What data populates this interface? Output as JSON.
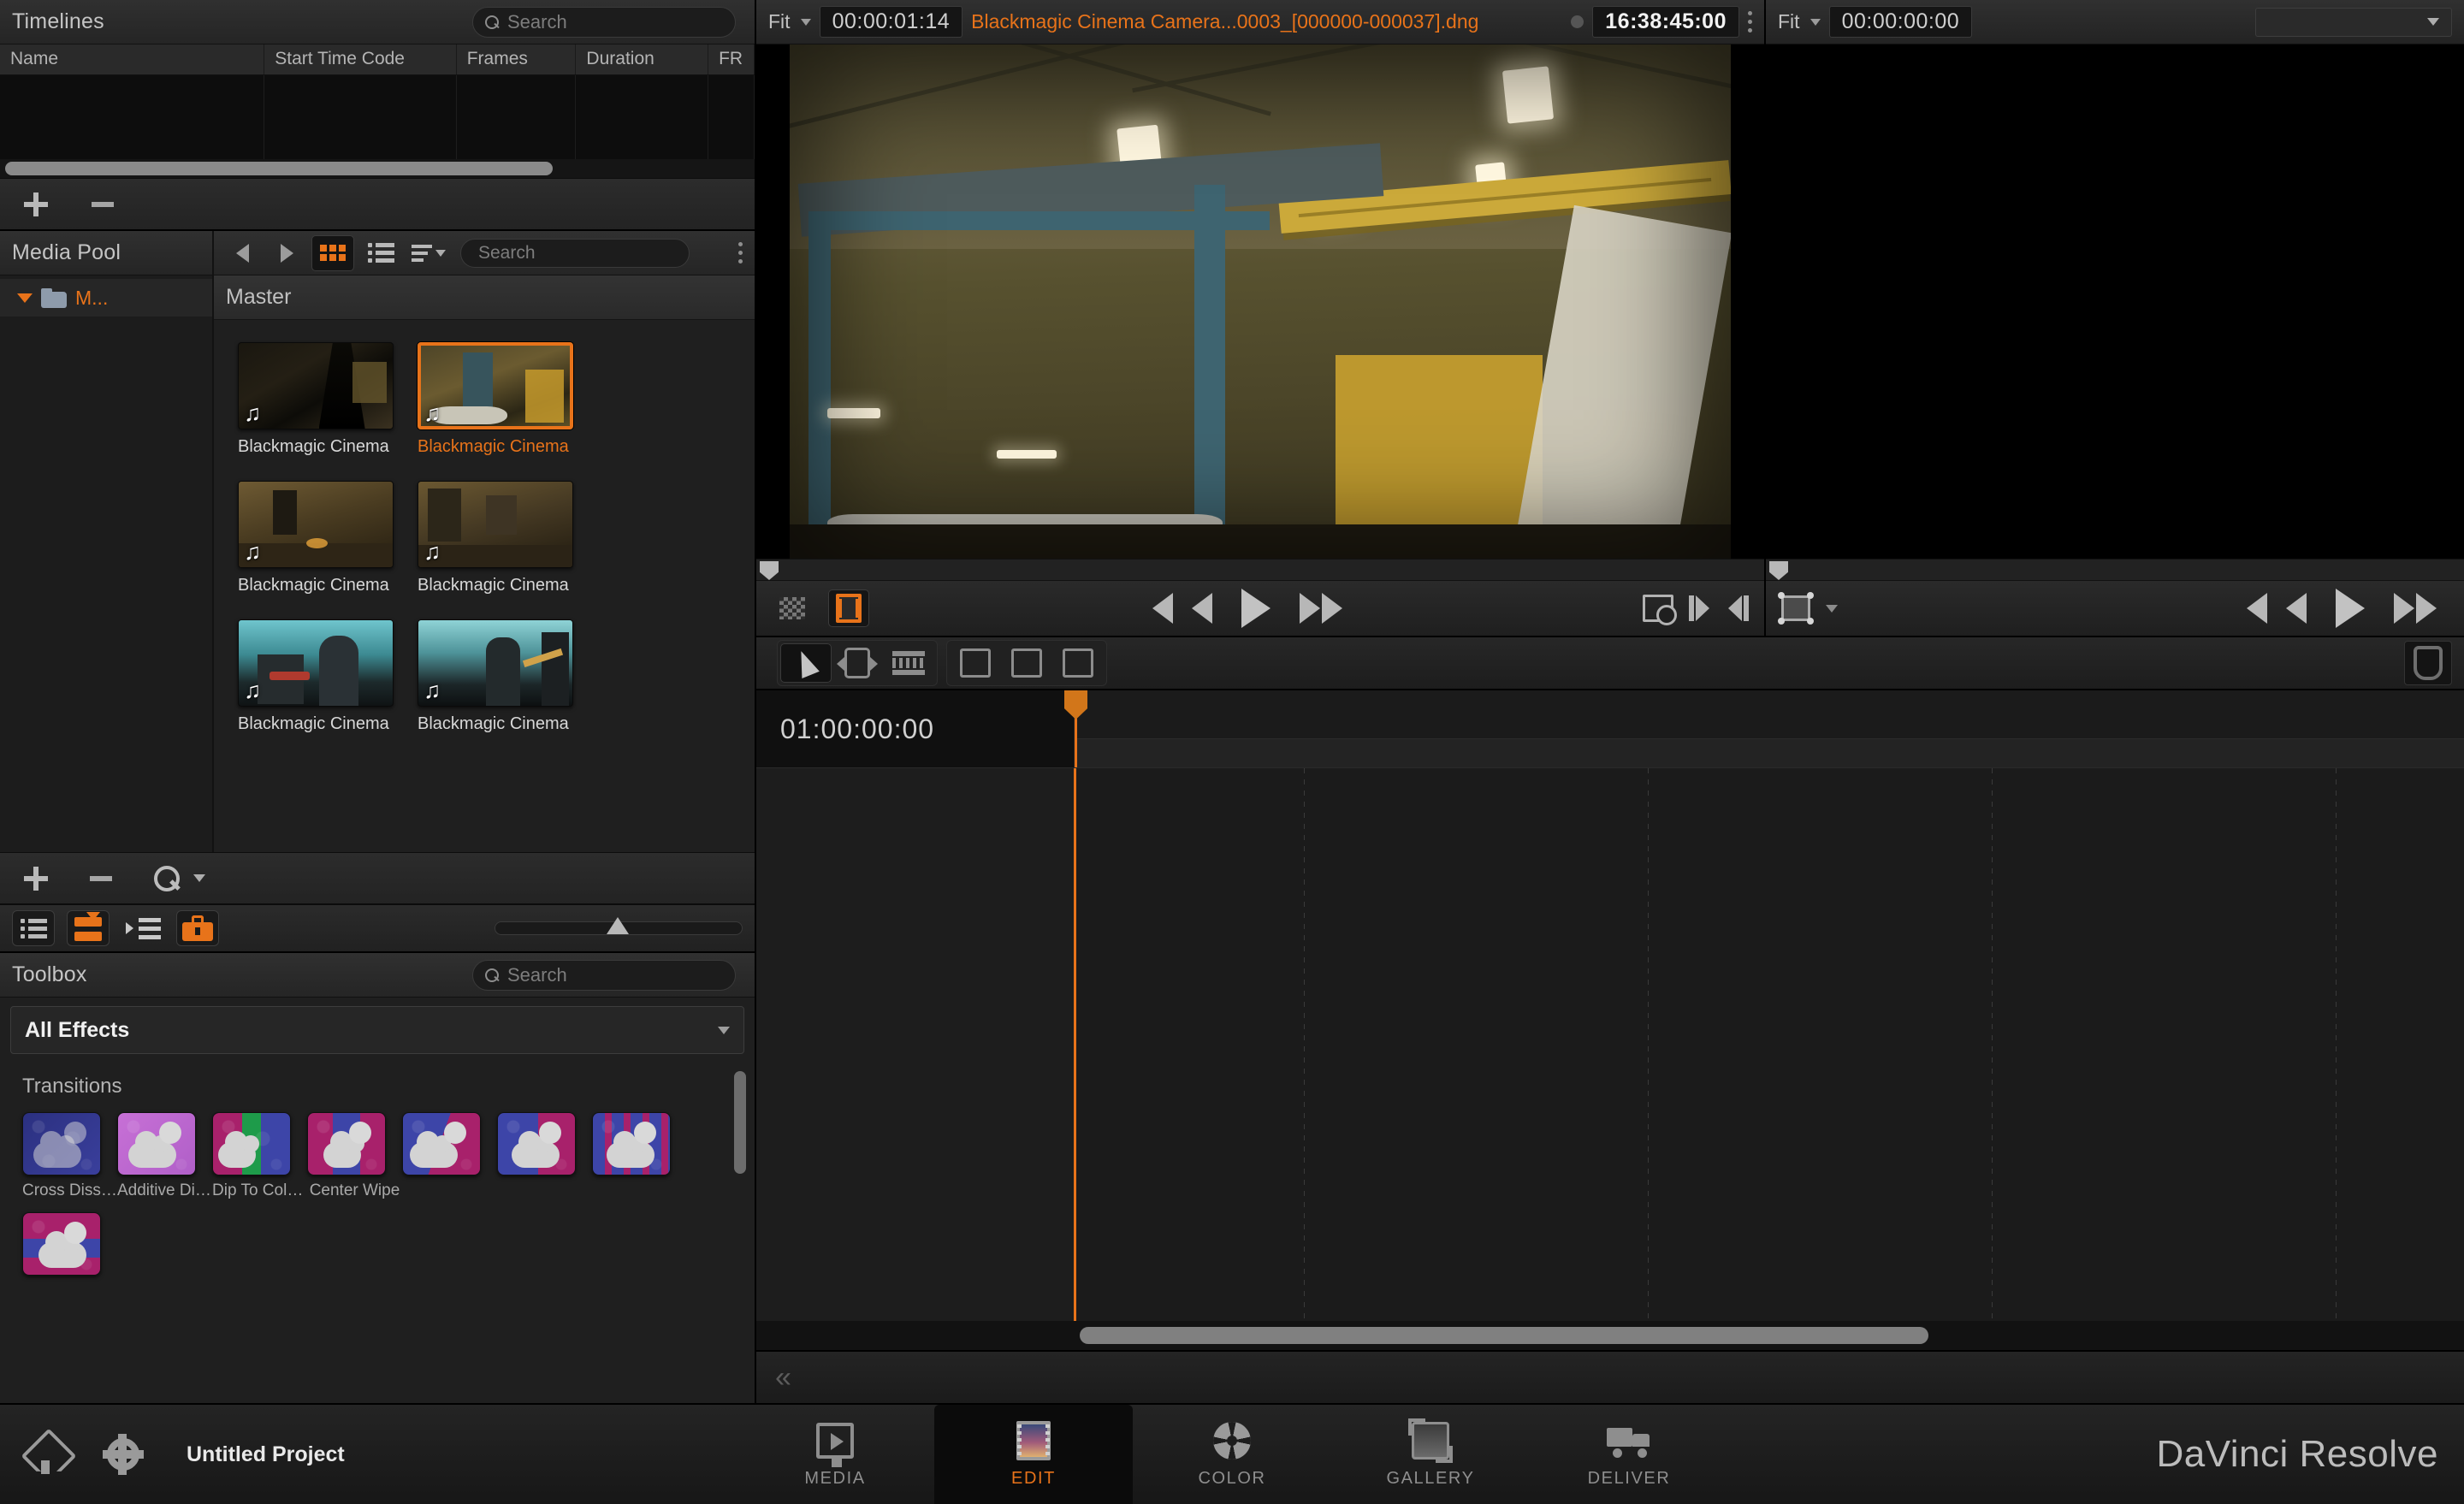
{
  "app": {
    "brand": "DaVinci Resolve"
  },
  "timelines_panel": {
    "title": "Timelines",
    "search_placeholder": "Search",
    "columns": [
      "Name",
      "Start Time Code",
      "Frames",
      "Duration",
      "FR"
    ],
    "rows": [],
    "add_label": "+",
    "remove_label": "–"
  },
  "media_pool": {
    "title": "Media Pool",
    "tree": [
      {
        "label": "M...",
        "expanded": true
      }
    ],
    "bin_header": "Master",
    "search_placeholder": "Search",
    "nav": {
      "back": "back-arrow",
      "forward": "forward-arrow"
    },
    "view_mode": "thumbnail",
    "clips": [
      {
        "label": "Blackmagic Cinema ...",
        "selected": false
      },
      {
        "label": "Blackmagic Cinema ...",
        "selected": true
      },
      {
        "label": "Blackmagic Cinema ...",
        "selected": false
      },
      {
        "label": "Blackmagic Cinema ...",
        "selected": false
      },
      {
        "label": "Blackmagic Cinema ...",
        "selected": false
      },
      {
        "label": "Blackmagic Cinema ...",
        "selected": false
      }
    ]
  },
  "toolbox": {
    "title": "Toolbox",
    "search_placeholder": "Search",
    "filter_selected": "All Effects",
    "sections": [
      {
        "title": "Transitions",
        "items": [
          {
            "label": "Cross Dissolve",
            "c1": "#2b3080",
            "c2": "#3a3f9c"
          },
          {
            "label": "Additive Dissolve",
            "c1": "#c770d6",
            "c2": "#b05fc8"
          },
          {
            "label": "Dip To Color Di...",
            "c1": "#a8216b",
            "c2": "#3d45a8"
          },
          {
            "label": "Center Wipe",
            "c1": "#a8216b",
            "c2": "#3d45a8"
          },
          {
            "label": "",
            "c1": "#3d45a8",
            "c2": "#a8216b"
          },
          {
            "label": "",
            "c1": "#3d45a8",
            "c2": "#a8216b"
          },
          {
            "label": "",
            "c1": "#3d45a8",
            "c2": "#a8216b"
          },
          {
            "label": "",
            "c1": "#a8216b",
            "c2": "#3d45a8"
          }
        ]
      }
    ]
  },
  "source_viewer": {
    "fit_label": "Fit",
    "timecode": "00:00:01:14",
    "clip_name": "Blackmagic Cinema Camera...0003_[000000-000037].dng",
    "duration_timecode": "16:38:45:00"
  },
  "timeline_viewer": {
    "fit_label": "Fit",
    "timecode": "00:00:00:00",
    "selector_value": ""
  },
  "timeline": {
    "start_timecode": "01:00:00:00",
    "playhead_position": "01:00:00:00",
    "tracks": []
  },
  "status_bar": {
    "project_name": "Untitled Project",
    "pages": [
      {
        "label": "MEDIA",
        "icon": "media-page-icon",
        "active": false
      },
      {
        "label": "EDIT",
        "icon": "edit-page-icon",
        "active": true
      },
      {
        "label": "COLOR",
        "icon": "color-page-icon",
        "active": false
      },
      {
        "label": "GALLERY",
        "icon": "gallery-page-icon",
        "active": false
      },
      {
        "label": "DELIVER",
        "icon": "deliver-page-icon",
        "active": false
      }
    ]
  },
  "colors": {
    "accent": "#e8731a",
    "panel_bg": "#1f1f1f",
    "header_bg": "#2a2a2a",
    "text": "#c8c8c8"
  }
}
